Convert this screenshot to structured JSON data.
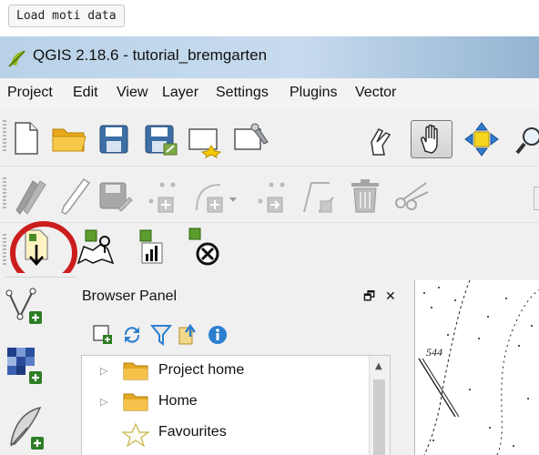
{
  "tooltip": {
    "text": "Load moti data"
  },
  "window": {
    "title": "QGIS 2.18.6 - tutorial_bremgarten",
    "accent_color": "#cc1d1d"
  },
  "menu": [
    {
      "label": "Project"
    },
    {
      "label": "Edit"
    },
    {
      "label": "View"
    },
    {
      "label": "Layer"
    },
    {
      "label": "Settings"
    },
    {
      "label": "Plugins"
    },
    {
      "label": "Vector"
    }
  ],
  "toolbar1": [
    "new-project-icon",
    "open-project-icon",
    "save-project-icon",
    "save-as-icon",
    "new-print-composer-icon",
    "composer-manager-icon",
    "touch-zoom-icon",
    "pan-hand-icon",
    "pan-to-selection-icon",
    "zoom-in-icon"
  ],
  "toolbar2": [
    "current-edits-icon",
    "toggle-editing-icon",
    "save-edits-icon",
    "add-feature-icon",
    "add-circular-string-icon",
    "move-feature-icon",
    "node-tool-icon",
    "delete-selected-icon",
    "cut-features-icon"
  ],
  "plugin_toolbar": [
    "load-moti-data-icon",
    "moti-map-icon",
    "moti-stats-icon",
    "moti-remove-icon"
  ],
  "sidebar": [
    "add-vector-layer-icon",
    "add-raster-layer-icon",
    "add-delimited-text-icon"
  ],
  "browser": {
    "title": "Browser Panel",
    "float_glyph": "🗗",
    "close_glyph": "✕",
    "tools": [
      "add-selected-icon",
      "refresh-icon",
      "filter-icon",
      "collapse-all-icon",
      "properties-icon"
    ],
    "items": [
      {
        "label": "Project home",
        "icon": "folder-icon",
        "expandable": true
      },
      {
        "label": "Home",
        "icon": "folder-icon",
        "expandable": true
      },
      {
        "label": "Favourites",
        "icon": "star-icon",
        "expandable": false
      }
    ]
  },
  "map": {
    "elevation_label": "544"
  }
}
